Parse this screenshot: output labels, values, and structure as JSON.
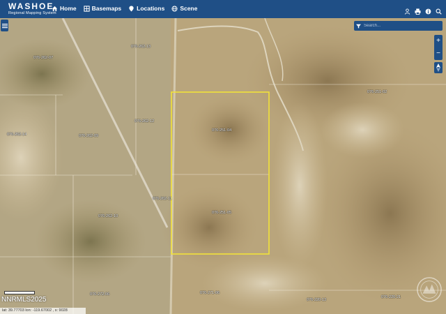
{
  "header": {
    "title": "WASHOE",
    "subtitle": "Regional Mapping System",
    "nav": [
      {
        "label": "Home",
        "icon": "home-icon"
      },
      {
        "label": "Basemaps",
        "icon": "layers-icon"
      },
      {
        "label": "Locations",
        "icon": "pin-icon"
      },
      {
        "label": "Scene",
        "icon": "globe-icon"
      }
    ],
    "right_icons": [
      "user-icon",
      "print-icon",
      "info-icon",
      "search-icon"
    ],
    "color": "#1f4f86"
  },
  "search": {
    "placeholder": "Search..."
  },
  "zoom": {
    "in": "+",
    "out": "−"
  },
  "parcels": [
    {
      "id": "p1",
      "label": "076-262-07"
    },
    {
      "id": "p2",
      "label": "076-262-13"
    },
    {
      "id": "p3",
      "label": "076-262-14"
    },
    {
      "id": "p4",
      "label": "076-262-12"
    },
    {
      "id": "p5",
      "label": "076-262-09"
    },
    {
      "id": "p6",
      "label": "076-251-04"
    },
    {
      "id": "p7",
      "label": "076-251-02"
    },
    {
      "id": "p8",
      "label": "076-262-11"
    },
    {
      "id": "p9",
      "label": "076-262-10"
    },
    {
      "id": "p10",
      "label": "076-251-05"
    },
    {
      "id": "p11",
      "label": "076-272-06"
    },
    {
      "id": "p12",
      "label": "076-271-06"
    },
    {
      "id": "p13",
      "label": "076-220-13"
    },
    {
      "id": "p14",
      "label": "076-220-21"
    }
  ],
  "watermark": "NNRMLS2025",
  "coordinates": "lat: 39.77703 lon: -119.67002 , s: 9028",
  "highlight_color": "#f2e23a"
}
